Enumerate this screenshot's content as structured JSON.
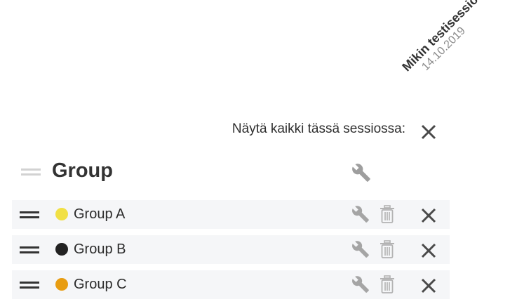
{
  "session": {
    "name": "Mikin testisessio",
    "date": "14.10.2019"
  },
  "show_all_label": "Näytä kaikki tässä sessiossa:",
  "group": {
    "title": "Group"
  },
  "items": [
    {
      "label": "Group A",
      "color": "#f1e045"
    },
    {
      "label": "Group B",
      "color": "#222222"
    },
    {
      "label": "Group C",
      "color": "#e89d12"
    }
  ],
  "icons": {
    "handle": "drag-handle-icon",
    "wrench": "wrench-icon",
    "trash": "trash-icon",
    "close": "close-icon"
  }
}
